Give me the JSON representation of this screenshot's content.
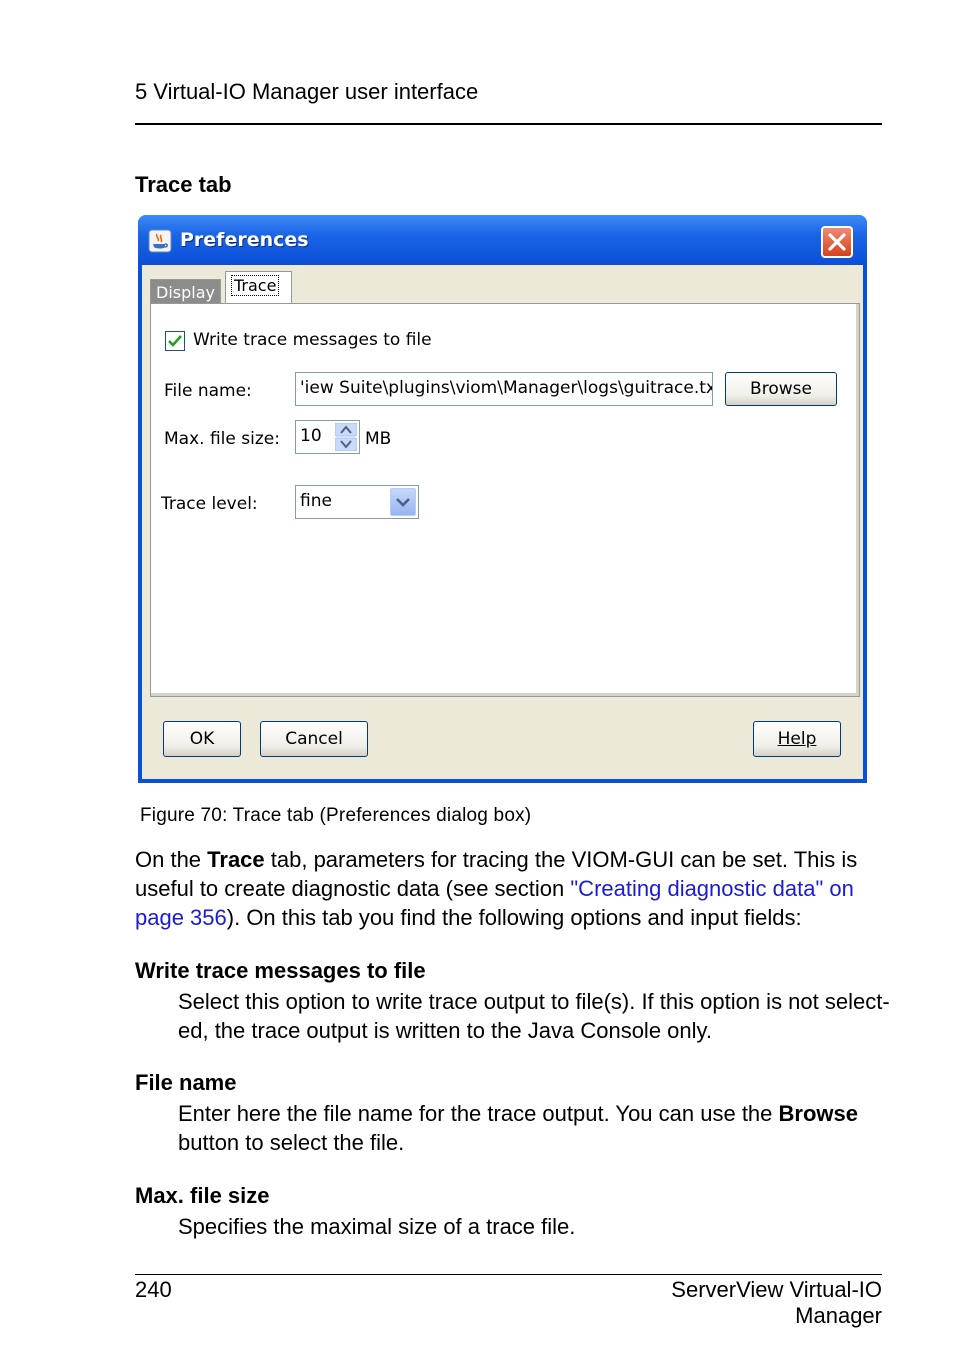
{
  "header": {
    "running_title": "5 Virtual-IO Manager user interface"
  },
  "section_title": "Trace tab",
  "dialog": {
    "title": "Preferences",
    "tabs": [
      "Display",
      "Trace"
    ],
    "active_tab": "Trace",
    "write_trace_label": "Write trace messages to file",
    "write_trace_checked": true,
    "file_name_label": "File name:",
    "file_name_value": "'iew Suite\\plugins\\viom\\Manager\\logs\\guitrace.txt",
    "browse_label": "Browse",
    "max_size_label": "Max. file size:",
    "max_size_value": "10",
    "max_size_unit": "MB",
    "trace_level_label": "Trace level:",
    "trace_level_value": "fine",
    "ok_label": "OK",
    "cancel_label": "Cancel",
    "help_label": "Help"
  },
  "caption": "Figure 70: Trace tab (Preferences dialog box)",
  "intro": {
    "part1": "On the ",
    "bold": "Trace",
    "part2": " tab, parameters for tracing the VIOM-GUI can be set. This is useful to create diagnostic data (see section ",
    "link": "\"Creating diagnostic data\" on page 356",
    "part3": "). On this tab you find the following options and input fields:"
  },
  "definitions": [
    {
      "term": "Write trace messages to file",
      "desc": "Select this option to write trace output to file(s). If this option is not select-ed, the trace output is written to the Java Console only."
    },
    {
      "term": "File name",
      "desc_part1": "Enter here the file name for the trace output. You can use the ",
      "desc_bold": "Browse",
      "desc_part2": " button to select the file."
    },
    {
      "term": "Max. file size",
      "desc": "Specifies the maximal size of a trace file."
    }
  ],
  "footer": {
    "page_number": "240",
    "product": "ServerView Virtual-IO Manager"
  }
}
